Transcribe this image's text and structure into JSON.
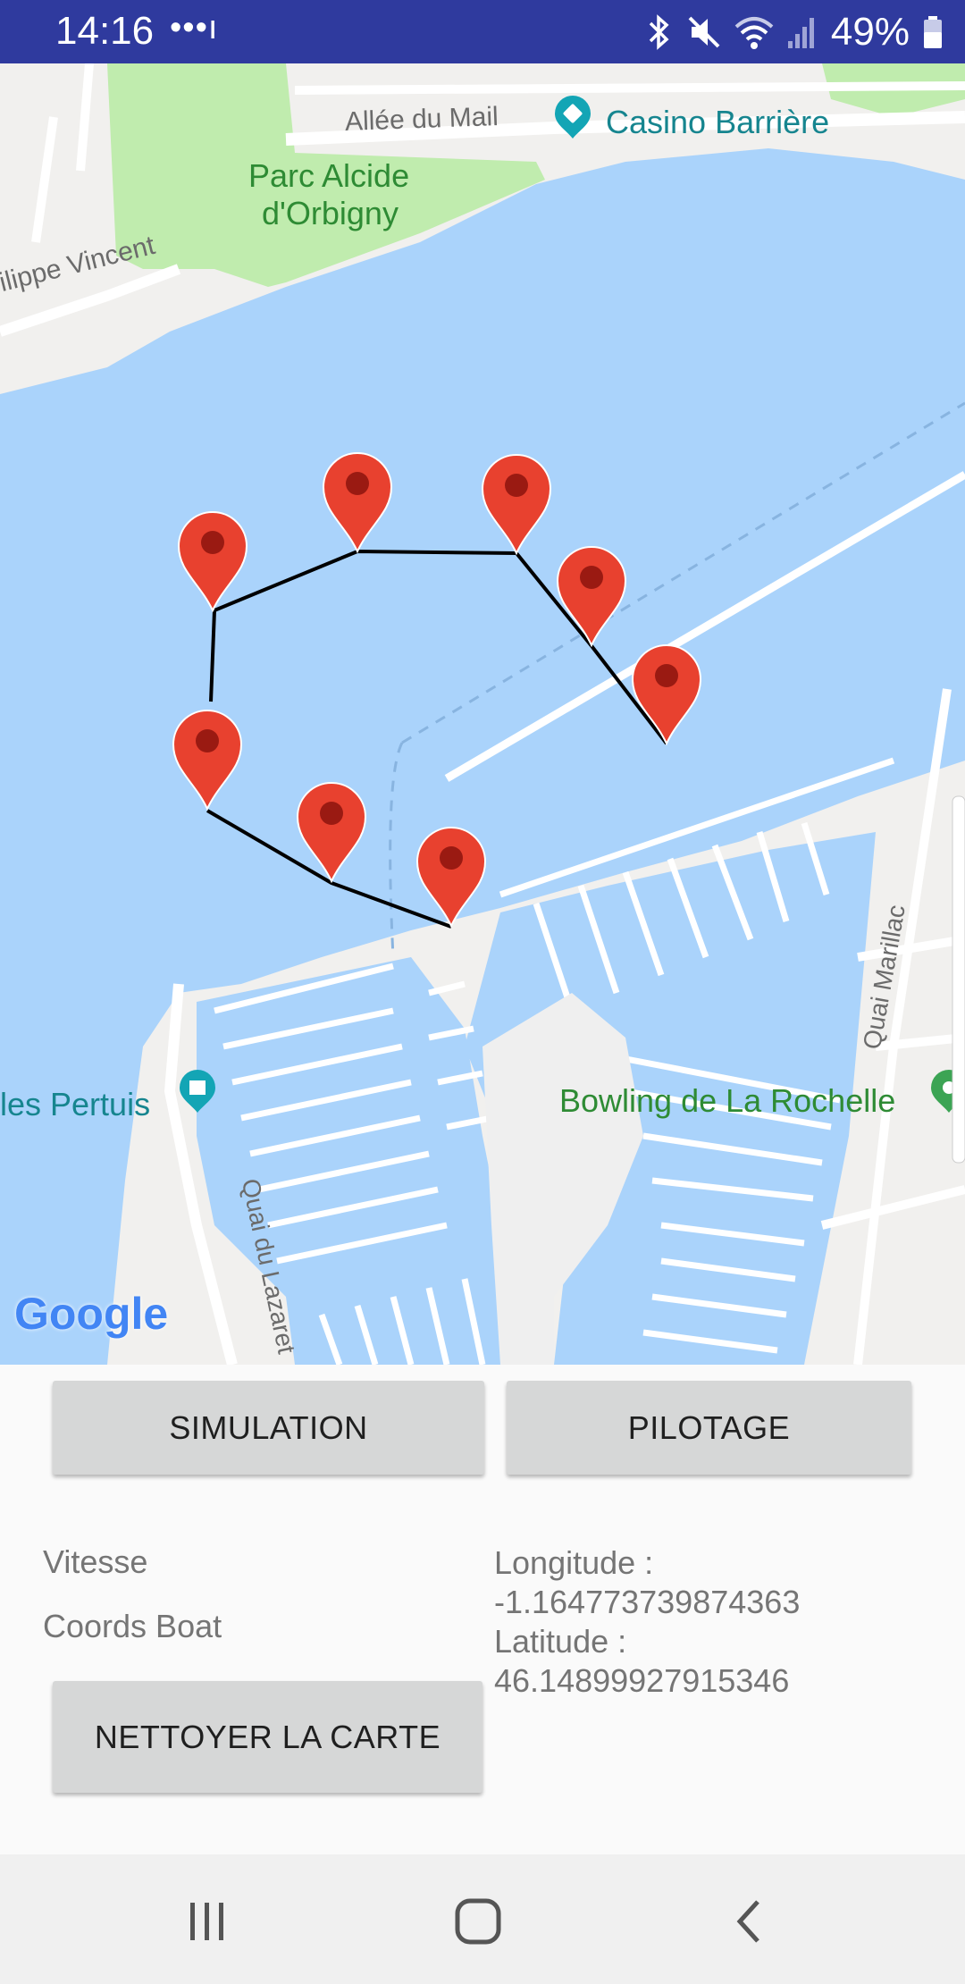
{
  "status_bar": {
    "time": "14:16",
    "dots": "•••ı",
    "battery": "49%",
    "icons": [
      "bluetooth-icon",
      "mute-icon",
      "wifi-icon",
      "signal-icon",
      "battery-icon"
    ]
  },
  "map": {
    "labels": {
      "allee_du_mail": "Allée du Mail",
      "casino": "Casino Barrière",
      "parc_line1": "Parc Alcide",
      "parc_line2": "d'Orbigny",
      "philippe": "ilippe Vincent",
      "pertuis": "les Pertuis",
      "bowling": "Bowling de La Rochelle",
      "quai_marillac": "Quai Marillac",
      "quai_lazaret": "Quai du Lazaret",
      "google": "Google"
    },
    "marker_color": "#e8412f",
    "route_color": "#000000",
    "water_color": "#aad3fb",
    "marker_count": 8
  },
  "controls": {
    "simulation_label": "SIMULATION",
    "pilotage_label": "PILOTAGE",
    "vitesse_label": "Vitesse",
    "coords_boat_label": "Coords Boat",
    "clean_label": "NETTOYER LA CARTE",
    "longitude_label": "Longitude :",
    "longitude_value": "-1.164773739874363",
    "latitude_label": "Latitude :",
    "latitude_value": "46.14899927915346"
  },
  "nav_bar": {
    "recents": "recents-icon",
    "home": "home-icon",
    "back": "back-icon"
  }
}
